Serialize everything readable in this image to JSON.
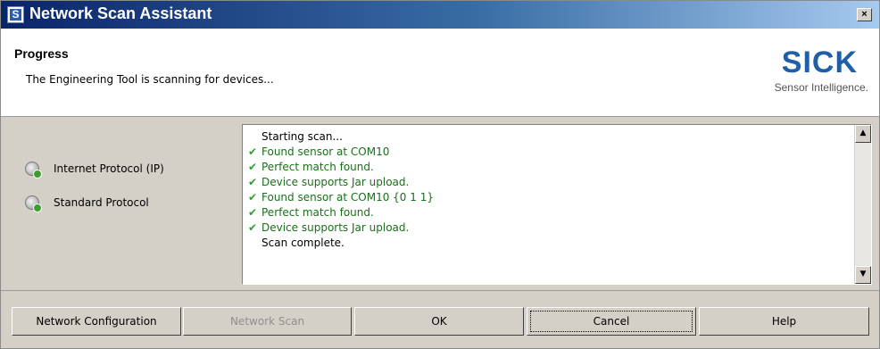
{
  "window": {
    "title": "Network Scan Assistant",
    "app_icon_letter": "S",
    "close_glyph": "×"
  },
  "header": {
    "title": "Progress",
    "subtitle": "The Engineering Tool is scanning for devices...",
    "logo_word": "SICK",
    "logo_tagline": "Sensor Intelligence."
  },
  "protocols": [
    {
      "label": "Internet Protocol (IP)",
      "icon": "globe-check-icon"
    },
    {
      "label": "Standard Protocol",
      "icon": "globe-check-icon"
    }
  ],
  "log": {
    "lines": [
      {
        "text": "Starting scan...",
        "status": "none"
      },
      {
        "text": "Found sensor at COM10",
        "status": "ok"
      },
      {
        "text": "Perfect match found.",
        "status": "ok"
      },
      {
        "text": "Device supports Jar upload.",
        "status": "ok"
      },
      {
        "text": "Found sensor at COM10 {0 1 1}",
        "status": "ok"
      },
      {
        "text": "Perfect match found.",
        "status": "ok"
      },
      {
        "text": "Device supports Jar upload.",
        "status": "ok"
      },
      {
        "text": "Scan complete.",
        "status": "none"
      }
    ],
    "check_glyph": "✔",
    "scroll_up_glyph": "▲",
    "scroll_down_glyph": "▼"
  },
  "buttons": {
    "network_configuration": "Network Configuration",
    "network_scan": "Network Scan",
    "ok": "OK",
    "cancel": "Cancel",
    "help": "Help"
  },
  "colors": {
    "titlebar_start": "#0a246a",
    "logo_blue": "#1f5fa8",
    "check_green": "#2f9e2f"
  }
}
